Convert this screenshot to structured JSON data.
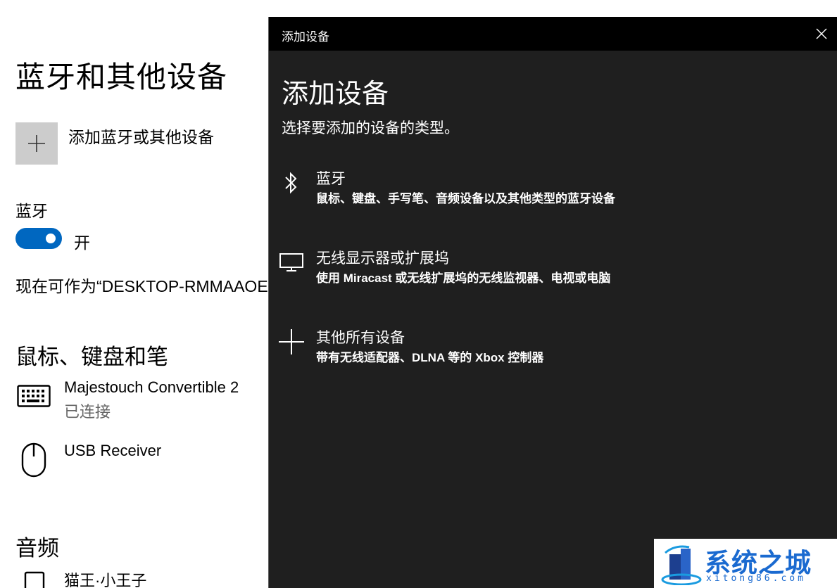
{
  "settings": {
    "title": "蓝牙和其他设备",
    "add_device_label": "添加蓝牙或其他设备",
    "bluetooth_label": "蓝牙",
    "bluetooth_state": "开",
    "bluetooth_on": true,
    "discoverable_text": "现在可作为“DESKTOP-RMMAAOE”被",
    "sections": {
      "input": {
        "heading": "鼠标、键盘和笔",
        "devices": [
          {
            "name": "Majestouch Convertible 2",
            "status": "已连接",
            "icon": "keyboard-icon"
          },
          {
            "name": "USB Receiver",
            "status": "",
            "icon": "mouse-icon"
          }
        ]
      },
      "audio": {
        "heading": "音频",
        "devices": [
          {
            "name": "猫王·小王子",
            "icon": "speaker-icon"
          }
        ]
      }
    },
    "accent_color": "#0067c0"
  },
  "dialog": {
    "window_title": "添加设备",
    "heading": "添加设备",
    "subtitle": "选择要添加的设备的类型。",
    "options": [
      {
        "title": "蓝牙",
        "desc": "鼠标、键盘、手写笔、音频设备以及其他类型的蓝牙设备",
        "icon": "bluetooth-icon"
      },
      {
        "title": "无线显示器或扩展坞",
        "desc": "使用 Miracast 或无线扩展坞的无线监视器、电视或电脑",
        "icon": "monitor-icon"
      },
      {
        "title": "其他所有设备",
        "desc": "带有无线适配器、DLNA 等的 Xbox 控制器",
        "icon": "plus-icon"
      }
    ]
  },
  "watermark": {
    "brand": "系统之城",
    "site": "xitong86.com"
  }
}
